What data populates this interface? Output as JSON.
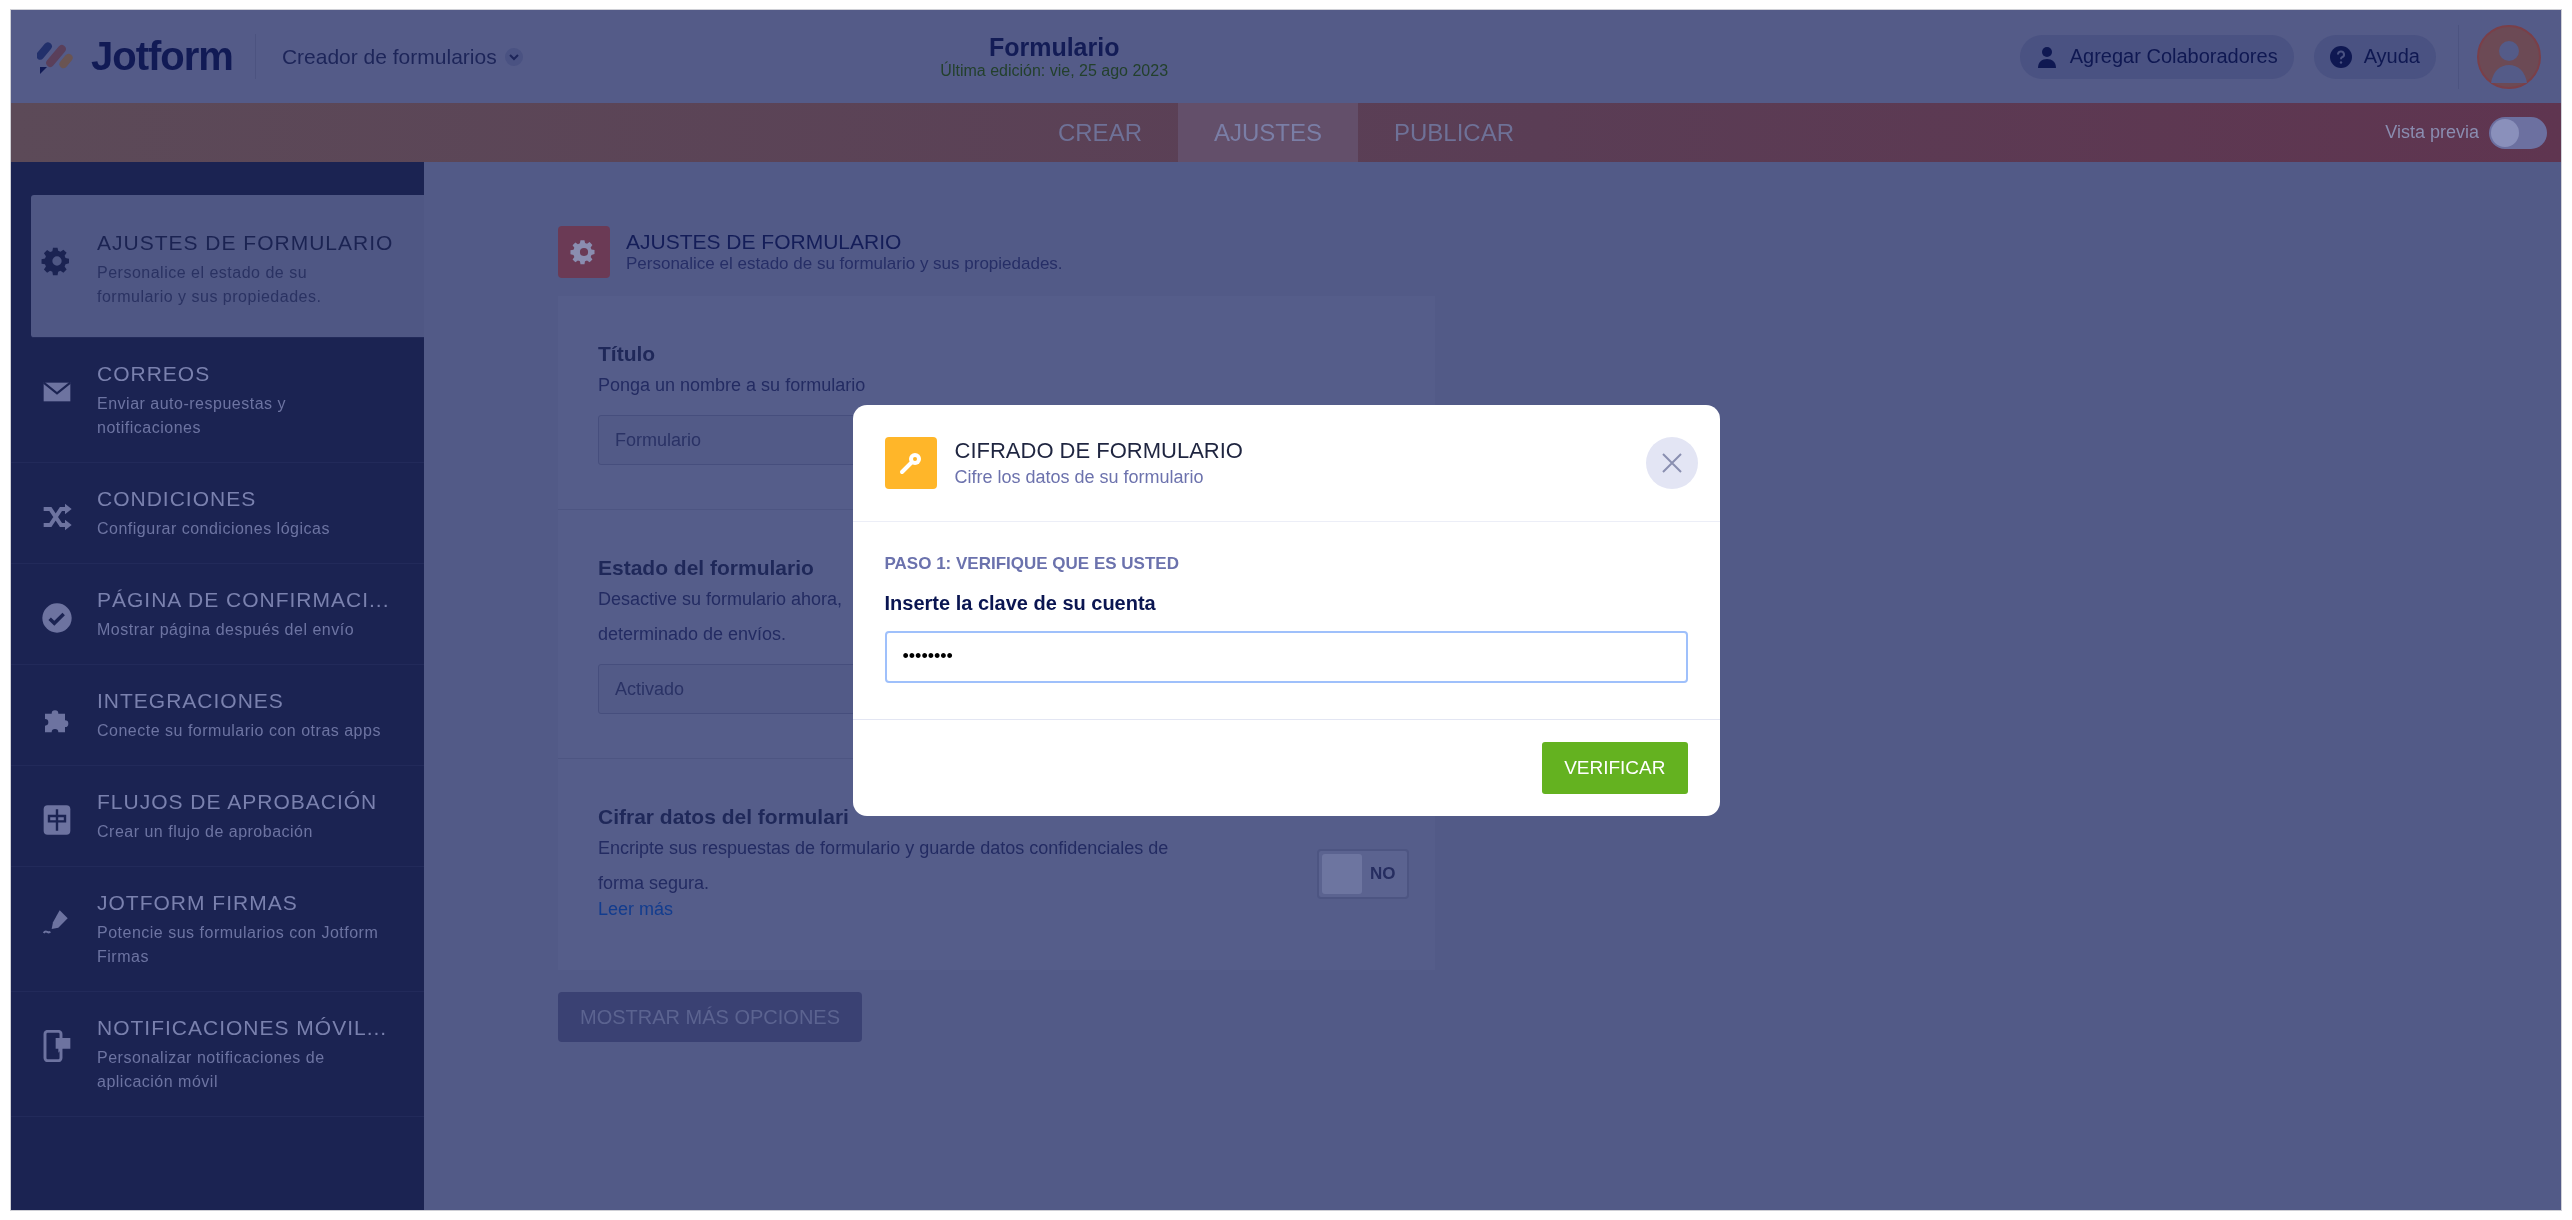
{
  "header": {
    "logo": "Jotform",
    "builder_menu": "Creador de formularios",
    "form_title": "Formulario",
    "last_edited": "Última edición: vie, 25 ago 2023",
    "buttons": [
      {
        "label": "Agregar Colaboradores",
        "kind": "person"
      },
      {
        "label": "Ayuda",
        "kind": "help"
      }
    ]
  },
  "nav": {
    "tabs": [
      {
        "label": "CREAR",
        "selected": false
      },
      {
        "label": "AJUSTES",
        "selected": true
      },
      {
        "label": "PUBLICAR",
        "selected": false
      }
    ],
    "preview": {
      "label": "Vista previa",
      "on": false
    }
  },
  "sidebar": {
    "items": [
      {
        "kind": "gear",
        "title": "AJUSTES DE FORMULARIO",
        "subtitle": "Personalice el estado de su formulario y sus propiedades.",
        "selected": true
      },
      {
        "kind": "mail",
        "title": "CORREOS",
        "subtitle": "Enviar auto-respuestas y notificaciones",
        "selected": false
      },
      {
        "kind": "shuffle",
        "title": "CONDICIONES",
        "subtitle": "Configurar condiciones lógicas",
        "selected": false
      },
      {
        "kind": "check",
        "title": "PÁGINA DE CONFIRMACI...",
        "subtitle": "Mostrar página después del envío",
        "selected": false
      },
      {
        "kind": "puzzle",
        "title": "INTEGRACIONES",
        "subtitle": "Conecte su formulario con otras apps",
        "selected": false
      },
      {
        "kind": "flow",
        "title": "FLUJOS DE APROBACIÓN",
        "subtitle": "Crear un flujo de aprobación",
        "selected": false
      },
      {
        "kind": "pen",
        "title": "JOTFORM FIRMAS",
        "subtitle": "Potencie sus formularios con Jotform Firmas",
        "selected": false
      },
      {
        "kind": "phone",
        "title": "NOTIFICACIONES MÓVIL...",
        "subtitle": "Personalizar notificaciones de aplicación móvil",
        "selected": false
      }
    ]
  },
  "section": {
    "title": "AJUSTES DE FORMULARIO",
    "subtitle": "Personalice el estado de su formulario y sus propiedades."
  },
  "settings": [
    {
      "kind": "text",
      "label": "Título",
      "description_lines": [
        "Ponga un nombre a su formulario"
      ],
      "value": "Formulario"
    },
    {
      "kind": "select",
      "label": "Estado del formulario",
      "description_lines": [
        "Desactive su formulario ahora,",
        "determinado de envíos."
      ],
      "value": "Activado"
    },
    {
      "kind": "toggle",
      "label": "Cifrar datos del formulari",
      "description_lines": [
        "Encripte sus respuestas de formulario y guarde datos confidenciales de",
        "forma segura."
      ],
      "link": "Leer más",
      "toggle": {
        "label": "NO",
        "on": false
      }
    }
  ],
  "more_button": "MOSTRAR MÁS OPCIONES",
  "modal": {
    "title": "CIFRADO DE FORMULARIO",
    "subtitle": "Cifre los datos de su formulario",
    "step": "PASO 1: VERIFIQUE QUE ES USTED",
    "field_label": "Inserte la clave de su cuenta",
    "password": "••••••••",
    "button": "VERIFICAR"
  }
}
